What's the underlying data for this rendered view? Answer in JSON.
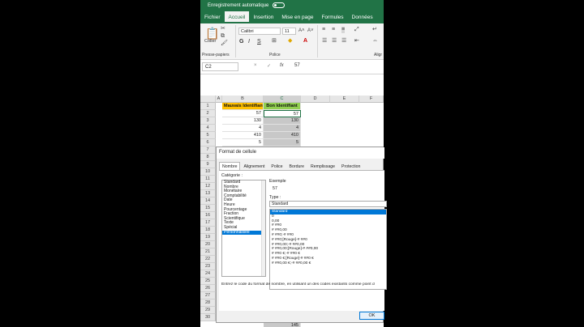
{
  "titlebar": {
    "autosave": "Enregistrement automatique"
  },
  "tabs": [
    "Fichier",
    "Accueil",
    "Insertion",
    "Mise en page",
    "Formules",
    "Données"
  ],
  "ribbon": {
    "paste_label": "Coller",
    "font_name": "Calibri",
    "font_size": "11",
    "bold": "G",
    "italic": "I",
    "underline": "S",
    "group_clipboard": "Presse-papiers",
    "group_font": "Police",
    "group_align": "Aligr"
  },
  "formula_bar": {
    "cell_ref": "C2",
    "cancel": "×",
    "confirm": "✓",
    "fx": "fx",
    "value": "57"
  },
  "grid": {
    "columns": [
      "A",
      "B",
      "C",
      "D",
      "E",
      "F"
    ],
    "header_row": {
      "b": "Mauvais Identifiant",
      "c": "Bon Identifiant"
    },
    "rows": [
      {
        "num": "1"
      },
      {
        "num": "2",
        "b": "57",
        "c": "57"
      },
      {
        "num": "3",
        "b": "130",
        "c": "130"
      },
      {
        "num": "4",
        "b": "4",
        "c": "4"
      },
      {
        "num": "5",
        "b": "410",
        "c": "410"
      },
      {
        "num": "6",
        "b": "5",
        "c": "5"
      }
    ],
    "visible_row_numbers": [
      "7",
      "8",
      "9",
      "10",
      "11",
      "12",
      "13",
      "14",
      "15",
      "16",
      "17",
      "18",
      "19",
      "20",
      "21",
      "22",
      "23",
      "24",
      "25",
      "26",
      "27",
      "28",
      "29",
      "30"
    ],
    "bottom_value": "145"
  },
  "dialog": {
    "title": "Format de cellule",
    "tabs": [
      "Nombre",
      "Alignement",
      "Police",
      "Bordure",
      "Remplissage",
      "Protection"
    ],
    "category_label": "Catégorie :",
    "categories": [
      "Standard",
      "Nombre",
      "Monétaire",
      "Comptabilité",
      "Date",
      "Heure",
      "Pourcentage",
      "Fraction",
      "Scientifique",
      "Texte",
      "Spécial",
      "Personnalisée"
    ],
    "example_label": "Exemple",
    "example_value": "57",
    "type_label": "Type :",
    "type_value": "Standard",
    "formats": [
      "Standard",
      "0",
      "0,00",
      "# ##0",
      "# ##0,00",
      "# ##0;-# ##0",
      "# ##0;[Rouge]-# ##0",
      "# ##0,00;-# ##0,00",
      "# ##0,00;[Rouge]-# ##0,00",
      "# ##0 €;-# ##0 €",
      "# ##0 €;[Rouge]-# ##0 €",
      "# ##0,00 €;-# ##0,00 €"
    ],
    "description": "Entrez le code du format de nombre, en utilisant un des codes existants comme point d",
    "ok_label": "OK"
  },
  "colors": {
    "excel_green": "#217346",
    "header_yellow": "#ffc000",
    "header_green": "#92d050",
    "selection": "#0078d7"
  }
}
